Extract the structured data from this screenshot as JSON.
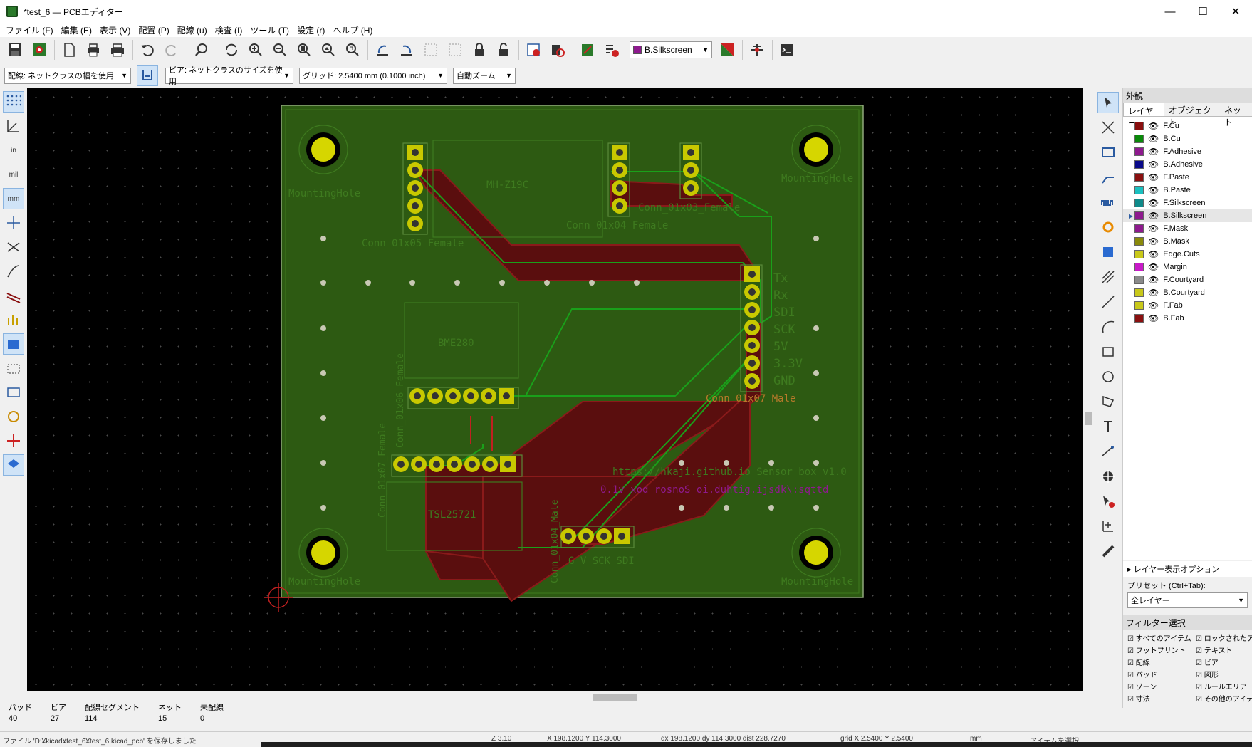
{
  "window": {
    "title": "*test_6 — PCBエディター",
    "minimize": "—",
    "maximize": "☐",
    "close": "✕"
  },
  "menu": [
    "ファイル (F)",
    "編集 (E)",
    "表示 (V)",
    "配置 (P)",
    "配線 (u)",
    "検査 (I)",
    "ツール (T)",
    "設定 (r)",
    "ヘルプ (H)"
  ],
  "toolbar": {
    "active_layer": "B.Silkscreen",
    "active_layer_color": "#8e1a8e"
  },
  "toolbar2": {
    "track_width": "配線: ネットクラスの幅を使用",
    "via_size": "ビア: ネットクラスのサイズを使用",
    "grid": "グリッド: 2.5400 mm (0.1000 inch)",
    "zoom": "自動ズーム"
  },
  "left_toolbar": {
    "in": "in",
    "mil": "mil",
    "mm": "mm"
  },
  "board": {
    "background": "#000000",
    "board_fill": "#2d5a12",
    "copper_color": "#5a0e0e",
    "silk_text_color": "#3e7a1f",
    "mounting_hole_label": "MountingHole",
    "refs": [
      "Conn_01x05_Female",
      "MH-Z19C",
      "Conn_01x04_Female",
      "Conn_01x03_Female",
      "Conn_01x07_Male",
      "BME280",
      "Conn_01x06_Female",
      "Conn_01x07_Female",
      "TSL25721",
      "Conn_01x04_Male"
    ],
    "pin_labels": [
      "Tx",
      "Rx",
      "SDI",
      "SCK",
      "5V",
      "3.3V",
      "GND"
    ],
    "bottom_pins_label": "G V SCK SDI",
    "url_text": "https://hkaji.github.io Sensor box v1.0",
    "mirrored_text": "0.1v xod rosnoS oi.duhtig.ijsdk\\:sqttd"
  },
  "panel": {
    "title": "外観",
    "tabs": [
      "レイヤー",
      "オブジェクト",
      "ネット"
    ],
    "layers": [
      {
        "name": "F.Cu",
        "color": "#8a1010"
      },
      {
        "name": "B.Cu",
        "color": "#0a8a0a"
      },
      {
        "name": "F.Adhesive",
        "color": "#8e1a8e"
      },
      {
        "name": "B.Adhesive",
        "color": "#0a0a8a"
      },
      {
        "name": "F.Paste",
        "color": "#8a1010"
      },
      {
        "name": "B.Paste",
        "color": "#1ac0c0"
      },
      {
        "name": "F.Silkscreen",
        "color": "#108a8a"
      },
      {
        "name": "B.Silkscreen",
        "color": "#8e1a8e"
      },
      {
        "name": "F.Mask",
        "color": "#8e1a8e"
      },
      {
        "name": "B.Mask",
        "color": "#8a8a0a"
      },
      {
        "name": "Edge.Cuts",
        "color": "#c8c81a"
      },
      {
        "name": "Margin",
        "color": "#c81ac8"
      },
      {
        "name": "F.Courtyard",
        "color": "#8a8a8a"
      },
      {
        "name": "B.Courtyard",
        "color": "#c8c81a"
      },
      {
        "name": "F.Fab",
        "color": "#c8c81a"
      },
      {
        "name": "B.Fab",
        "color": "#8a1010"
      }
    ],
    "layer_display_options": "レイヤー表示オプション",
    "preset_label": "プリセット (Ctrl+Tab):",
    "preset_value": "全レイヤー",
    "filter_title": "フィルター選択",
    "filters": [
      "すべてのアイテム",
      "ロックされたアイ",
      "フットプリント",
      "テキスト",
      "配線",
      "ビア",
      "パッド",
      "図形",
      "ゾーン",
      "ルールエリア",
      "寸法",
      "その他のアイテ"
    ]
  },
  "status": [
    {
      "label": "パッド",
      "value": "40"
    },
    {
      "label": "ビア",
      "value": "27"
    },
    {
      "label": "配線セグメント",
      "value": "114"
    },
    {
      "label": "ネット",
      "value": "15"
    },
    {
      "label": "未配線",
      "value": "0"
    }
  ],
  "message_bar": {
    "file_msg": "ファイル 'D:¥kicad¥test_6¥test_6.kicad_pcb' を保存しました",
    "z": "Z 3.10",
    "xy": "X 198.1200  Y 114.3000",
    "dxy": "dx 198.1200  dy 114.3000  dist 228.7270",
    "grid": "grid X 2.5400  Y 2.5400",
    "unit": "mm",
    "mode": "アイテムを選択"
  }
}
